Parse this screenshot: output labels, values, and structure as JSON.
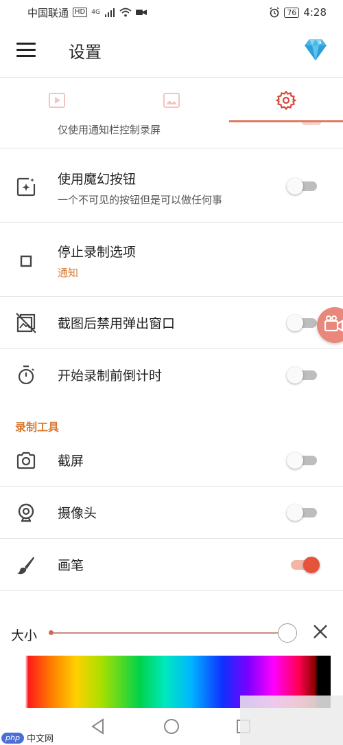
{
  "status_bar": {
    "carrier": "中国联通",
    "hd": "HD",
    "network": "4G",
    "battery": "76",
    "time": "4:28"
  },
  "app_bar": {
    "title": "设置"
  },
  "tabs": [
    {
      "name": "video",
      "icon": "video-play-icon",
      "selected": false
    },
    {
      "name": "image",
      "icon": "image-icon",
      "selected": false
    },
    {
      "name": "settings",
      "icon": "gear-icon",
      "selected": true
    }
  ],
  "settings": {
    "partial_item_subtitle": "仅使用通知栏控制录屏",
    "items": [
      {
        "title": "使用魔幻按钮",
        "subtitle": "一个不可见的按钮但是可以做任何事",
        "icon": "magic-button-icon",
        "toggle": false
      },
      {
        "title": "停止录制选项",
        "subtitle": "通知",
        "icon": "stop-square-icon"
      },
      {
        "title": "截图后禁用弹出窗口",
        "icon": "screenshot-popup-off-icon",
        "toggle": false
      },
      {
        "title": "开始录制前倒计时",
        "icon": "stopwatch-icon",
        "toggle": false
      }
    ]
  },
  "recording_tools": {
    "header": "录制工具",
    "items": [
      {
        "title": "截屏",
        "icon": "camera-icon",
        "toggle": false
      },
      {
        "title": "摄像头",
        "icon": "webcam-icon",
        "toggle": false
      },
      {
        "title": "画笔",
        "icon": "brush-icon",
        "toggle": true
      }
    ]
  },
  "brush": {
    "size_label": "大小",
    "size_level": 0.92
  },
  "colors": {
    "accent": "#d9782f",
    "toggle_on": "#e5533d",
    "indicator": "#e07a5f"
  },
  "watermark": {
    "php": "php",
    "text": "中文网"
  }
}
